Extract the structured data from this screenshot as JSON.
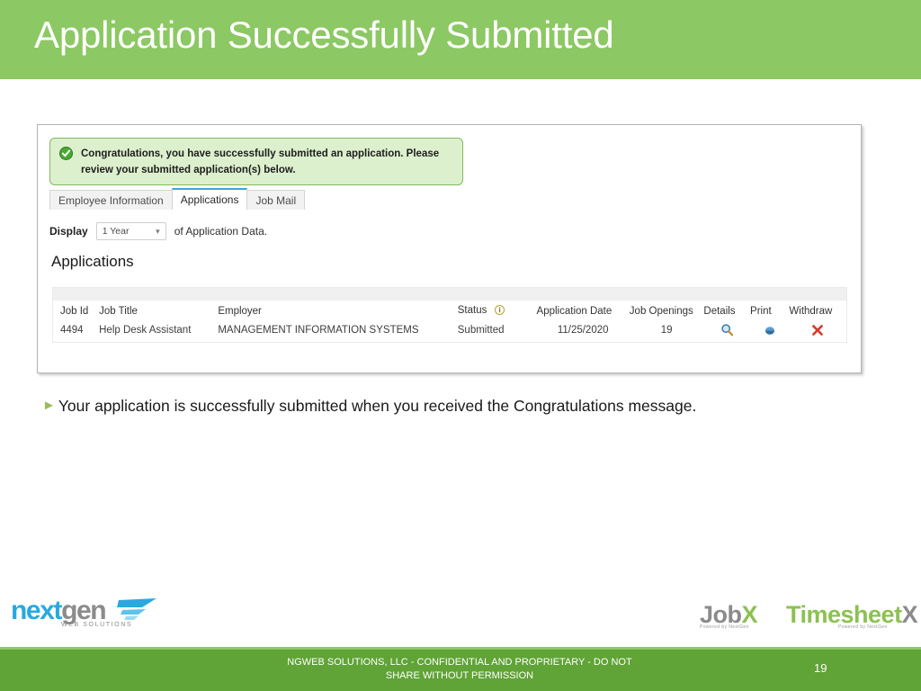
{
  "slide": {
    "title": "Application Successfully Submitted",
    "header_color": "#8cc863",
    "footer_color": "#60a336"
  },
  "screenshot": {
    "alert": {
      "icon": "green-check-circle-icon",
      "message": "Congratulations, you have successfully submitted an application. Please review your submitted application(s) below.",
      "background_color": "#ddf0cd",
      "border_color": "#7fbb5a"
    },
    "tabs": [
      {
        "label": "Employee Information",
        "active": false
      },
      {
        "label": "Applications",
        "active": true
      },
      {
        "label": "Job Mail",
        "active": false
      }
    ],
    "display_filter": {
      "label": "Display",
      "selected": "1 Year",
      "suffix": "of Application Data."
    },
    "section_heading": "Applications",
    "table": {
      "columns": [
        "Job Id",
        "Job Title",
        "Employer",
        "Status",
        "Application Date",
        "Job Openings",
        "Details",
        "Print",
        "Withdraw"
      ],
      "status_info_icon": "info-circle-icon",
      "rows": [
        {
          "job_id": "4494",
          "job_title": "Help Desk Assistant",
          "employer": "MANAGEMENT INFORMATION SYSTEMS",
          "status": "Submitted",
          "application_date": "11/25/2020",
          "job_openings": "19",
          "details_icon": "magnifier-icon",
          "print_icon": "printer-icon",
          "withdraw_icon": "red-x-icon"
        }
      ]
    }
  },
  "body": {
    "bullet_marker": "►",
    "bullet_text": "Your application is successfully submitted when you received the Congratulations message."
  },
  "logos": {
    "nextgen": {
      "part1": "next",
      "part2": "gen",
      "tagline": "WEB SOLUTIONS"
    },
    "jobx": {
      "word": "Job",
      "mark": "X",
      "powered": "Powered by NextGen"
    },
    "timesheetx": {
      "word": "Timesheet",
      "mark": "X",
      "powered": "Powered by NextGen"
    }
  },
  "footer": {
    "line1": "NGWEB SOLUTIONS, LLC - CONFIDENTIAL AND  PROPRIETARY - DO NOT",
    "line2": "SHARE WITHOUT PERMISSION",
    "page_number": "19"
  }
}
